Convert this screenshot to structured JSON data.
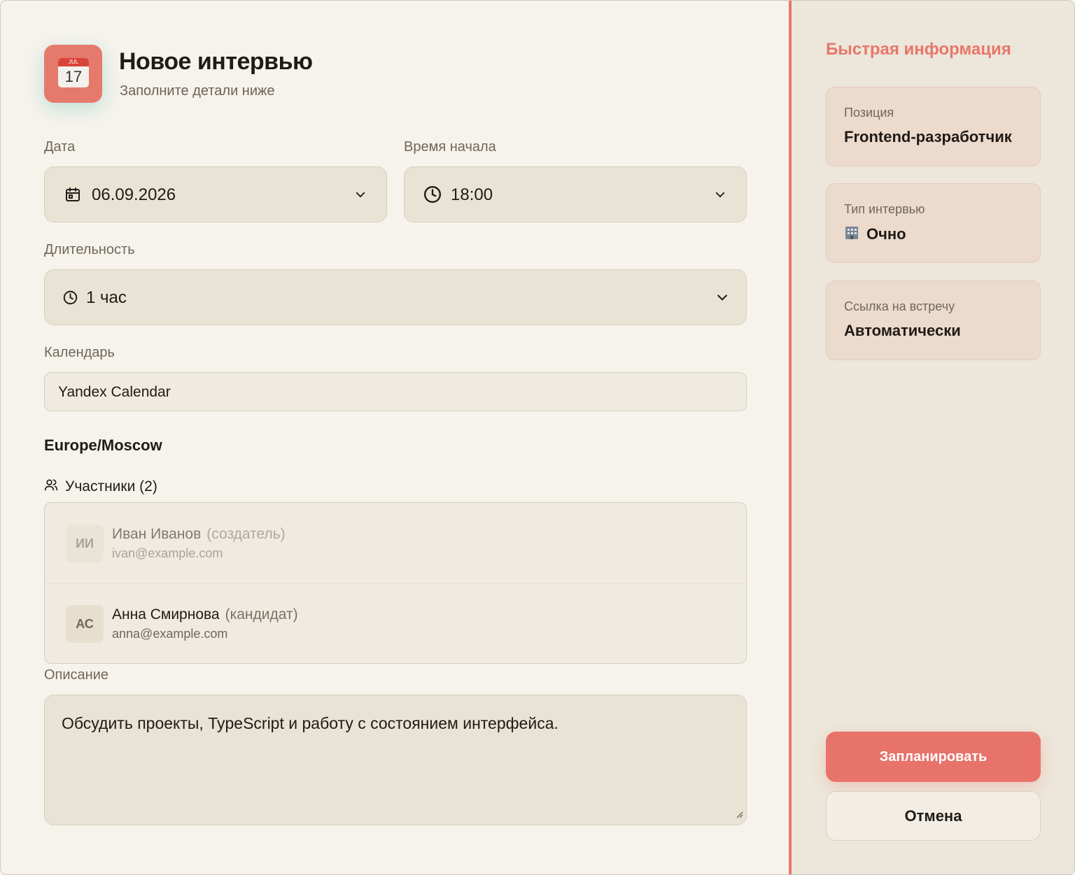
{
  "header": {
    "icon_month": "JUL",
    "icon_day": "17",
    "title": "Новое интервью",
    "subtitle": "Заполните детали ниже"
  },
  "form": {
    "date": {
      "label": "Дата",
      "value": "06.09.2026"
    },
    "time": {
      "label": "Время начала",
      "value": "18:00"
    },
    "duration": {
      "label": "Длительность",
      "value": "1 час"
    },
    "calendar": {
      "label": "Календарь",
      "value": "Yandex Calendar"
    },
    "timezone": "Europe/Moscow",
    "participants": {
      "title": "Участники (2)",
      "items": [
        {
          "initials": "ИИ",
          "name": "Иван Иванов",
          "role": "(создатель)",
          "email": "ivan@example.com"
        },
        {
          "initials": "АС",
          "name": "Анна Смирнова",
          "role": "(кандидат)",
          "email": "anna@example.com"
        }
      ]
    },
    "description": {
      "label": "Описание",
      "value": "Обсудить проекты, TypeScript и работу с состоянием интерфейса."
    }
  },
  "sidebar": {
    "title": "Быстрая информация",
    "cards": [
      {
        "label": "Позиция",
        "value": "Frontend-разработчик"
      },
      {
        "label": "Тип интервью",
        "icon": "office-building-icon",
        "value": "Очно"
      },
      {
        "label": "Ссылка на встречу",
        "value": "Автоматически"
      }
    ],
    "schedule_button": "Запланировать",
    "cancel_button": "Отмена"
  },
  "colors": {
    "accent": "#e8766a",
    "background": "#f6f3ec",
    "sidebar_background": "#ede6da",
    "field_background": "#e9e3d5"
  }
}
